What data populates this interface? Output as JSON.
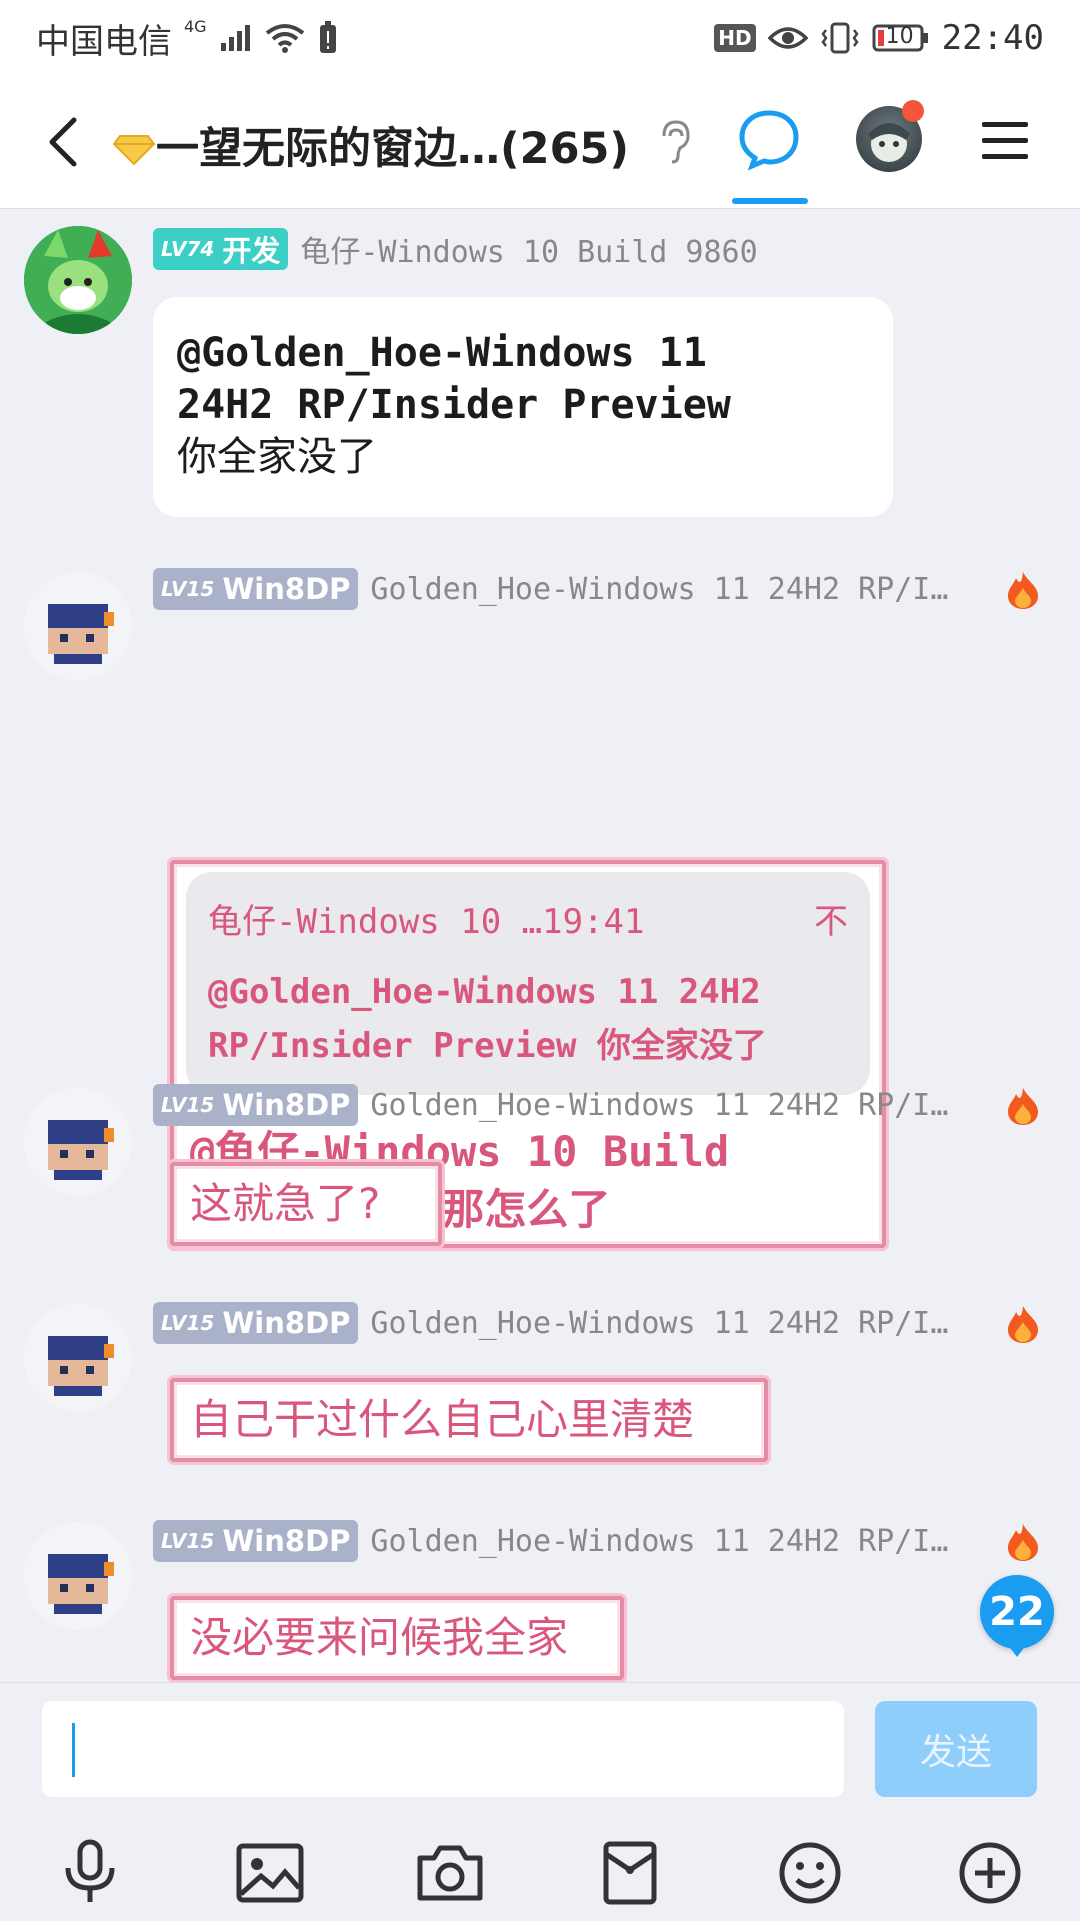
{
  "status_bar": {
    "carrier": "中国电信",
    "network": "4G",
    "hd_label": "HD",
    "battery_level": "10",
    "time": "22:40"
  },
  "header": {
    "group_name": "一望无际的窗边…",
    "member_count": "(265)",
    "colors": {
      "accent": "#1a9cf0"
    }
  },
  "messages": [
    {
      "badge_level": "LV74",
      "badge_title": "开发",
      "badge_color": "#3ccfc5",
      "sender": "龟仔-Windows 10 Build 9860",
      "text_line1": "@Golden_Hoe-Windows 11",
      "text_line2": "24H2 RP/Insider Preview",
      "text_line3": "你全家没了"
    },
    {
      "badge_level": "LV15",
      "badge_title": "Win8DP",
      "badge_color": "#a9b2c9",
      "sender": "Golden_Hoe-Windows 11 24H2 RP/I…",
      "quote_author": "龟仔-Windows 10 …",
      "quote_time": "19:41",
      "quote_action": "不",
      "quote_line1": "@Golden_Hoe-Windows 11 24H2",
      "quote_line2": "RP/Insider Preview 你全家没了",
      "reply_line1": "@龟仔-Windows 10 Build",
      "reply_line2": "9860 对对，那怎么了"
    },
    {
      "badge_level": "LV15",
      "badge_title": "Win8DP",
      "sender": "Golden_Hoe-Windows 11 24H2 RP/I…",
      "text": "这就急了?"
    },
    {
      "badge_level": "LV15",
      "badge_title": "Win8DP",
      "sender": "Golden_Hoe-Windows 11 24H2 RP/I…",
      "text": "自己干过什么自己心里清楚"
    },
    {
      "badge_level": "LV15",
      "badge_title": "Win8DP",
      "sender": "Golden_Hoe-Windows 11 24H2 RP/I…",
      "text": "没必要来问候我全家"
    }
  ],
  "unread_count": "22",
  "composer": {
    "input_value": "",
    "send_label": "发送"
  },
  "toolbar_icons": [
    "mic-icon",
    "image-icon",
    "camera-icon",
    "red-packet-icon",
    "emoji-icon",
    "plus-icon"
  ]
}
